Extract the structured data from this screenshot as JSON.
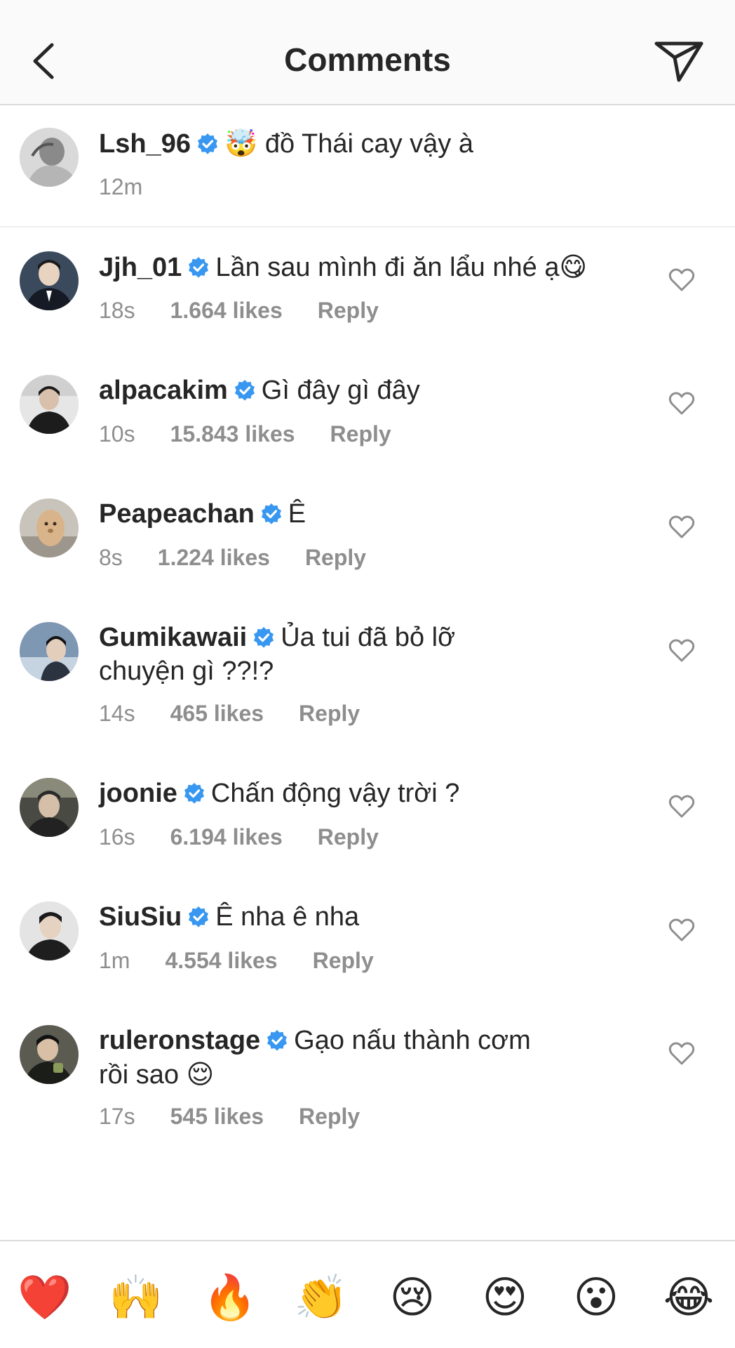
{
  "header": {
    "title": "Comments",
    "back_icon": "chevron-left-icon",
    "send_icon": "paper-plane-icon"
  },
  "caption": {
    "username": "Lsh_96",
    "emoji": "🤯",
    "text": "đồ Thái cay vậy à",
    "time": "12m"
  },
  "comments": [
    {
      "username": "Jjh_01",
      "text": "Lần sau mình đi ăn lẩu nhé ạ",
      "emoji": "😋",
      "time": "18s",
      "likes": "1.664 likes",
      "reply": "Reply"
    },
    {
      "username": "alpacakim",
      "text": "Gì đây gì đây",
      "emoji": "",
      "time": "10s",
      "likes": "15.843 likes",
      "reply": "Reply"
    },
    {
      "username": "Peapeachan",
      "text": "Ê",
      "emoji": "",
      "time": "8s",
      "likes": "1.224 likes",
      "reply": "Reply"
    },
    {
      "username": "Gumikawaii",
      "text": "Ủa tui đã bỏ lỡ chuyện gì ??!?",
      "emoji": "",
      "time": "14s",
      "likes": "465 likes",
      "reply": "Reply"
    },
    {
      "username": "joonie",
      "text": "Chấn động vậy trời ?",
      "emoji": "",
      "time": "16s",
      "likes": "6.194 likes",
      "reply": "Reply"
    },
    {
      "username": "SiuSiu",
      "text": "Ê nha ê nha",
      "emoji": "",
      "time": "1m",
      "likes": "4.554 likes",
      "reply": "Reply"
    },
    {
      "username": "ruleronstage",
      "text": "Gạo nấu thành cơm rồi sao",
      "emoji": "😌",
      "time": "17s",
      "likes": "545 likes",
      "reply": "Reply"
    }
  ],
  "reactions": [
    "❤️",
    "🙌",
    "🔥",
    "👏",
    "😢",
    "😍",
    "😮",
    "😂"
  ],
  "colors": {
    "verified": "#3897f0",
    "muted_text": "#8e8e8e",
    "text": "#262626",
    "header_bg": "#fafafa"
  }
}
